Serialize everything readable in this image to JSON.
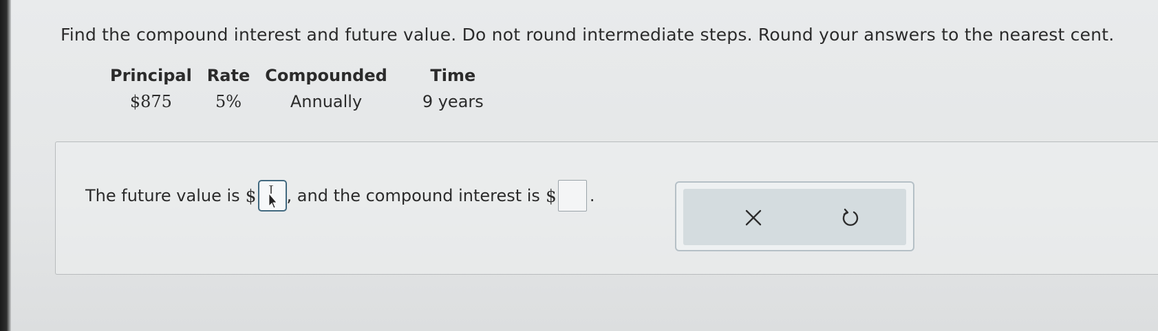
{
  "question": {
    "text": "Find the compound interest and future value. Do not round intermediate steps. Round your answers to the nearest cent."
  },
  "table": {
    "headers": [
      "Principal",
      "Rate",
      "Compounded",
      "Time"
    ],
    "values": [
      "$875",
      "5%",
      "Annually",
      "9 years"
    ]
  },
  "answer": {
    "prefix": "The future value is",
    "currency1": "$",
    "middle": ", and the compound interest is",
    "currency2": "$",
    "suffix": ".",
    "future_value": "",
    "compound_interest": ""
  },
  "actions": {
    "clear_icon": "close-icon",
    "reset_icon": "undo-icon"
  },
  "colors": {
    "input_active_border": "#41697f",
    "action_panel_bg": "#d4dcdf"
  }
}
